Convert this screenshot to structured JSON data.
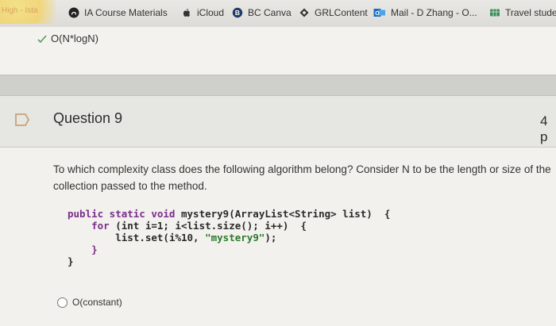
{
  "bookmarks": [
    {
      "label": "IA Course Materials",
      "icon": "github-icon"
    },
    {
      "label": "iCloud",
      "icon": "apple-icon"
    },
    {
      "label": "BC Canva",
      "icon": "canvas-b-icon"
    },
    {
      "label": "GRLContent",
      "icon": "diamond-icon"
    },
    {
      "label": "Mail - D Zhang - O...",
      "icon": "outlook-icon"
    },
    {
      "label": "Travel studer",
      "icon": "grid-icon"
    }
  ],
  "highlight_text": "High - Ista",
  "previous_question": {
    "selected_answer": "O(N*logN)"
  },
  "question": {
    "title": "Question 9",
    "points": "4 p",
    "text": "To which complexity class does the following algorithm belong? Consider N to be the length or size of the collection passed to the method.",
    "code": {
      "line1_kw": "public static void",
      "line1_rest": " mystery9(ArrayList<String> list)  {",
      "line2_kw": "for",
      "line2_rest": " (int i=1; i<list.size(); i++)  {",
      "line3": "list.set(i%10, ",
      "line3_str": "\"mystery9\"",
      "line3_end": ");",
      "line4": "}",
      "line5": "}"
    },
    "options": [
      {
        "label": "O(constant)",
        "selected": false
      }
    ]
  },
  "colors": {
    "code_keyword": "#7a2d8a",
    "code_string": "#2a7a2a"
  }
}
